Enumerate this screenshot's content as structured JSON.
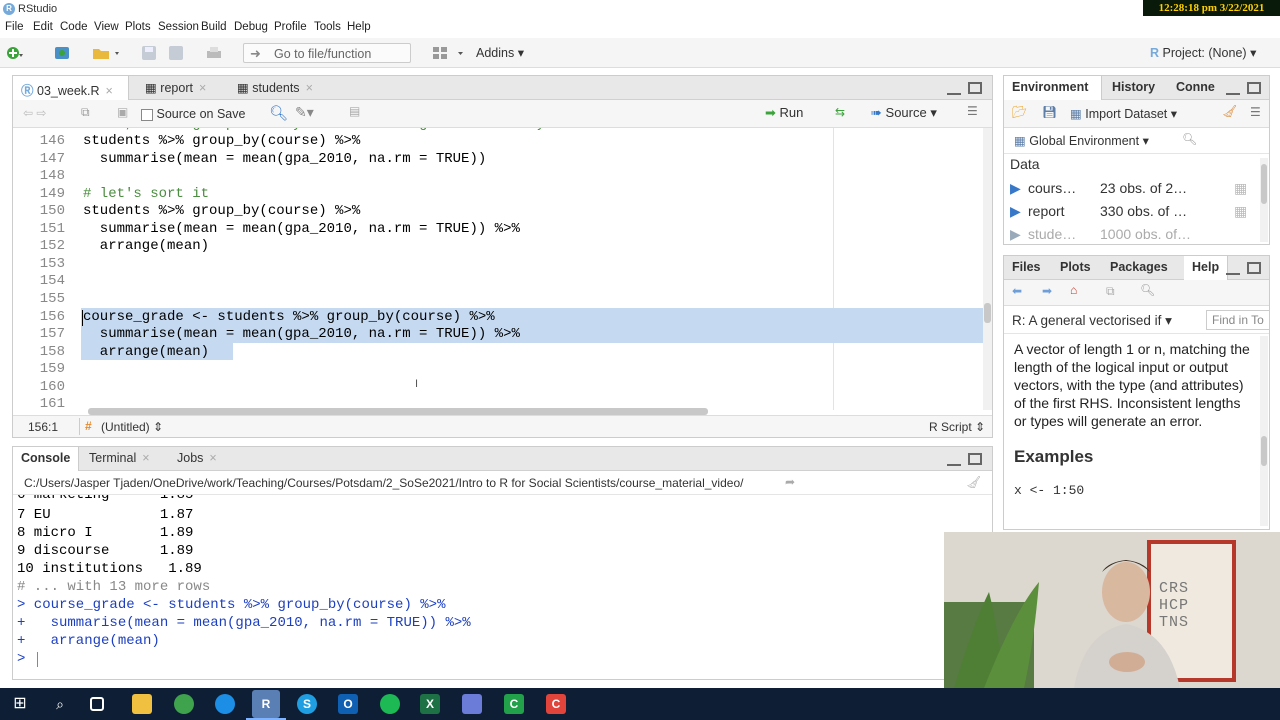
{
  "window": {
    "title": "RStudio",
    "clock": "12:28:18 pm 3/22/2021"
  },
  "menu": [
    "File",
    "Edit",
    "Code",
    "View",
    "Plots",
    "Session",
    "Build",
    "Debug",
    "Profile",
    "Tools",
    "Help"
  ],
  "toolbar": {
    "goto_placeholder": "Go to file/function",
    "addins_label": "Addins",
    "project_label": "Project: (None)"
  },
  "editor": {
    "tabs": [
      "03_week.R",
      "report",
      "students"
    ],
    "source_on_save": "Source on Save",
    "run_label": "Run",
    "source_label": "Source",
    "lines": [
      {
        "n": "146",
        "text": "students %>% group_by(course) %>%"
      },
      {
        "n": "147",
        "text": "  summarise(mean = mean(gpa_2010, na.rm = TRUE))"
      },
      {
        "n": "148",
        "text": ""
      },
      {
        "n": "149",
        "text": "# let's sort it"
      },
      {
        "n": "150",
        "text": "students %>% group_by(course) %>%"
      },
      {
        "n": "151",
        "text": "  summarise(mean = mean(gpa_2010, na.rm = TRUE)) %>%"
      },
      {
        "n": "152",
        "text": "  arrange(mean)"
      },
      {
        "n": "153",
        "text": ""
      },
      {
        "n": "154",
        "text": ""
      },
      {
        "n": "155",
        "text": ""
      },
      {
        "n": "156",
        "text": "course_grade <- students %>% group_by(course) %>%"
      },
      {
        "n": "157",
        "text": "  summarise(mean = mean(gpa_2010, na.rm = TRUE)) %>%"
      },
      {
        "n": "158",
        "text": "  arrange(mean)"
      },
      {
        "n": "159",
        "text": ""
      },
      {
        "n": "160",
        "text": ""
      },
      {
        "n": "161",
        "text": ""
      }
    ],
    "status_position": "156:1",
    "status_scope": "(Untitled)",
    "status_filetype": "R Script"
  },
  "console": {
    "tabs": [
      "Console",
      "Terminal",
      "Jobs"
    ],
    "path": "C:/Users/Jasper Tjaden/OneDrive/work/Teaching/Courses/Potsdam/2_SoSe2021/Intro to R for Social Scientists/course_material_video/",
    "output": [
      {
        "text": "6 marketing      1.85",
        "cls": ""
      },
      {
        "text": "7 EU             1.87",
        "cls": ""
      },
      {
        "text": "8 micro I        1.89",
        "cls": ""
      },
      {
        "text": "9 discourse      1.89",
        "cls": ""
      },
      {
        "text": "10 institutions   1.89",
        "cls": ""
      },
      {
        "text": "# ... with 13 more rows",
        "cls": "gray"
      },
      {
        "text": "> course_grade <- students %>% group_by(course) %>%",
        "cls": "blue"
      },
      {
        "text": "+   summarise(mean = mean(gpa_2010, na.rm = TRUE)) %>%",
        "cls": "blue"
      },
      {
        "text": "+   arrange(mean)",
        "cls": "blue"
      },
      {
        "text": "> ",
        "cls": "blue"
      }
    ]
  },
  "environment": {
    "tabs": [
      "Environment",
      "History",
      "Conne"
    ],
    "import_label": "Import Dataset",
    "scope_label": "Global Environment",
    "section_label": "Data",
    "rows": [
      {
        "name": "cours…",
        "desc": "23 obs. of 2…"
      },
      {
        "name": "report",
        "desc": "330 obs. of …"
      },
      {
        "name": "stude…",
        "desc": "1000 obs. of…"
      }
    ]
  },
  "help": {
    "tabs": [
      "Files",
      "Plots",
      "Packages",
      "Help"
    ],
    "topic": "R: A general vectorised if",
    "find_placeholder": "Find in To",
    "body": "A vector of length 1 or n, matching the length of the logical input or output vectors, with the type (and attributes) of the first RHS. Inconsistent lengths or types will generate an error.",
    "examples_heading": "Examples",
    "example_code": "x <- 1:50"
  },
  "video": {
    "sign_text": "CRS HCP TNS"
  },
  "colors": {
    "accent": "#75aadb",
    "selection": "#c5d9f1",
    "taskbar": "#0d1e35"
  }
}
